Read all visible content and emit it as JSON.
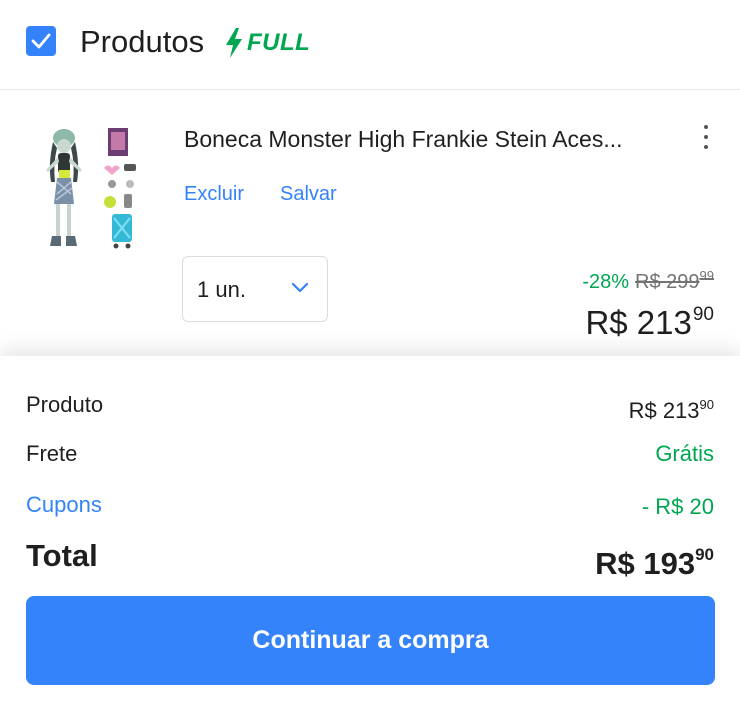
{
  "header": {
    "checked": true,
    "title": "Produtos",
    "badge": "FULL",
    "badge_color": "#00a650"
  },
  "product": {
    "title": "Boneca Monster High Frankie Stein Aces...",
    "thumbnail_icon": "doll-product-image",
    "actions": {
      "delete_label": "Excluir",
      "save_label": "Salvar"
    },
    "quantity_label": "1 un.",
    "discount": "-28%",
    "old_price_int": "R$ 299",
    "old_price_cents": "99",
    "price_int": "R$ 213",
    "price_cents": "90"
  },
  "summary": {
    "product_label": "Produto",
    "product_value_int": "R$ 213",
    "product_value_cents": "90",
    "shipping_label": "Frete",
    "shipping_value": "Grátis",
    "coupons_label": "Cupons",
    "coupons_value": "- R$ 20",
    "total_label": "Total",
    "total_value_int": "R$ 193",
    "total_value_cents": "90"
  },
  "cta": {
    "label": "Continuar a compra"
  },
  "colors": {
    "accent": "#3483fa",
    "positive": "#00a650",
    "text": "#1f1f1f"
  }
}
